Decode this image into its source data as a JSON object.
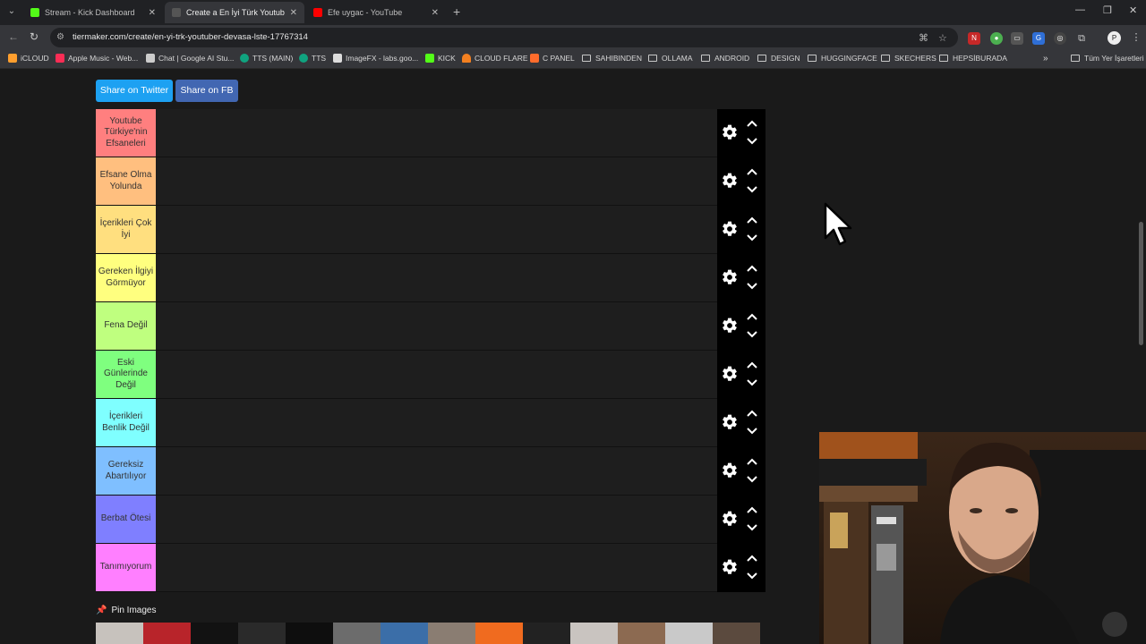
{
  "browser": {
    "tabs": [
      {
        "title": "Stream - Kick Dashboard",
        "favicon_color": "#53fc18",
        "active": false
      },
      {
        "title": "Create a En İyi Türk Youtuber D",
        "favicon_color": "#444444",
        "active": true
      },
      {
        "title": "Efe uygac - YouTube",
        "favicon_color": "#ff0000",
        "active": false
      }
    ],
    "url": "tiermaker.com/create/en-yi-trk-youtuber-devasa-lste-17767314",
    "bookmarks": [
      {
        "label": "iCLOUD",
        "icon_color": "#ff9f2e",
        "folder": false
      },
      {
        "label": "Apple Music - Web...",
        "icon_color": "#fa2d55",
        "folder": false
      },
      {
        "label": "Chat | Google AI Stu...",
        "icon_color": "#cccccc",
        "folder": false
      },
      {
        "label": "TTS (MAIN)",
        "icon_color": "#10a37f",
        "folder": false
      },
      {
        "label": "TTS",
        "icon_color": "#10a37f",
        "folder": false
      },
      {
        "label": "ImageFX - labs.goo...",
        "icon_color": "#dddddd",
        "folder": false
      },
      {
        "label": "KICK",
        "icon_color": "#53fc18",
        "folder": false
      },
      {
        "label": "CLOUD FLARE",
        "icon_color": "#f38020",
        "folder": false
      },
      {
        "label": "C PANEL",
        "icon_color": "#ff6c2c",
        "folder": false
      },
      {
        "label": "SAHIBINDEN",
        "folder": true
      },
      {
        "label": "OLLAMA",
        "folder": true
      },
      {
        "label": "ANDROID",
        "folder": true
      },
      {
        "label": "DESIGN",
        "folder": true
      },
      {
        "label": "HUGGINGFACE",
        "folder": true
      },
      {
        "label": "SKECHERS",
        "folder": true
      },
      {
        "label": "HEPSİBURADA",
        "folder": true
      }
    ],
    "all_bookmarks_label": "Tüm Yer İşaretleri"
  },
  "share": {
    "twitter_label": "Share on Twitter",
    "fb_label": "Share on FB"
  },
  "tiers": [
    {
      "label": "Youtube Türkiye'nin Efsaneleri",
      "color": "#ff7f7f"
    },
    {
      "label": "Efsane Olma Yolunda",
      "color": "#ffbf7f"
    },
    {
      "label": "İçerikleri Çok İyi",
      "color": "#ffdf7f"
    },
    {
      "label": "Gereken İlgiyi Görmüyor",
      "color": "#ffff7f"
    },
    {
      "label": "Fena Değil",
      "color": "#bfff7f"
    },
    {
      "label": "Eski Günlerinde Değil",
      "color": "#7fff7f"
    },
    {
      "label": "İçerikleri Benlik Değil",
      "color": "#7fffff"
    },
    {
      "label": "Gereksiz Abartılıyor",
      "color": "#7fbfff"
    },
    {
      "label": "Berbat Ötesi",
      "color": "#7f7fff"
    },
    {
      "label": "Tanımıyorum",
      "color": "#ff7fff"
    }
  ],
  "pin_images_label": "Pin Images",
  "thumbnail_colors": [
    "#c7c2bd",
    "#b8242a",
    "#121212",
    "#2a2a2a",
    "#0e0e0e",
    "#6c6c6c",
    "#3b6ea8",
    "#8a7d72",
    "#f06b1f",
    "#222222",
    "#c9c4c0",
    "#8c6a51",
    "#c9c9c9",
    "#5b4a3e"
  ]
}
